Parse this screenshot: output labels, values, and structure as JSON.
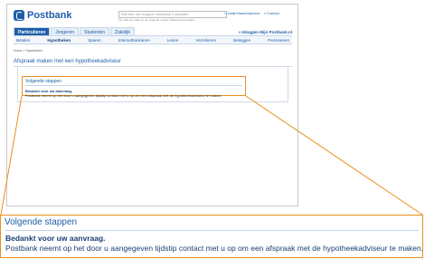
{
  "brand": {
    "name": "Postbank"
  },
  "search": {
    "placeholder": "Stel hier uw vraag en minimaal 3 woorden",
    "button_label": "Zoek",
    "hint": "Tip: Stel uw vraag op de volgende manier: Rekening aanvragen"
  },
  "top_links": [
    "Klantenservice",
    "Contact"
  ],
  "tabs": [
    "Particulieren",
    "Jongeren",
    "Studenten",
    "Zakelijk"
  ],
  "login_label": "Inloggen Mijn Postbank.nl",
  "subnav": [
    "Betalen",
    "Hypotheken",
    "Sparen",
    "Internetbankieren",
    "Lenen",
    "Verzekeren",
    "Beleggen",
    "Pensioenen"
  ],
  "breadcrumb": "Home > Hypotheken",
  "page_heading": "Afspraak maken met een hypotheekadviseur",
  "confirmation": {
    "title": "Volgende stappen",
    "thanks": "Bedankt voor uw aanvraag.",
    "message": "Postbank neemt op het door u aangegeven tijdstip contact met u op om een afspraak met de hypotheekadviseur te maken."
  },
  "colors": {
    "brand_blue": "#1f5fa8",
    "callout_orange": "#e8901e"
  }
}
